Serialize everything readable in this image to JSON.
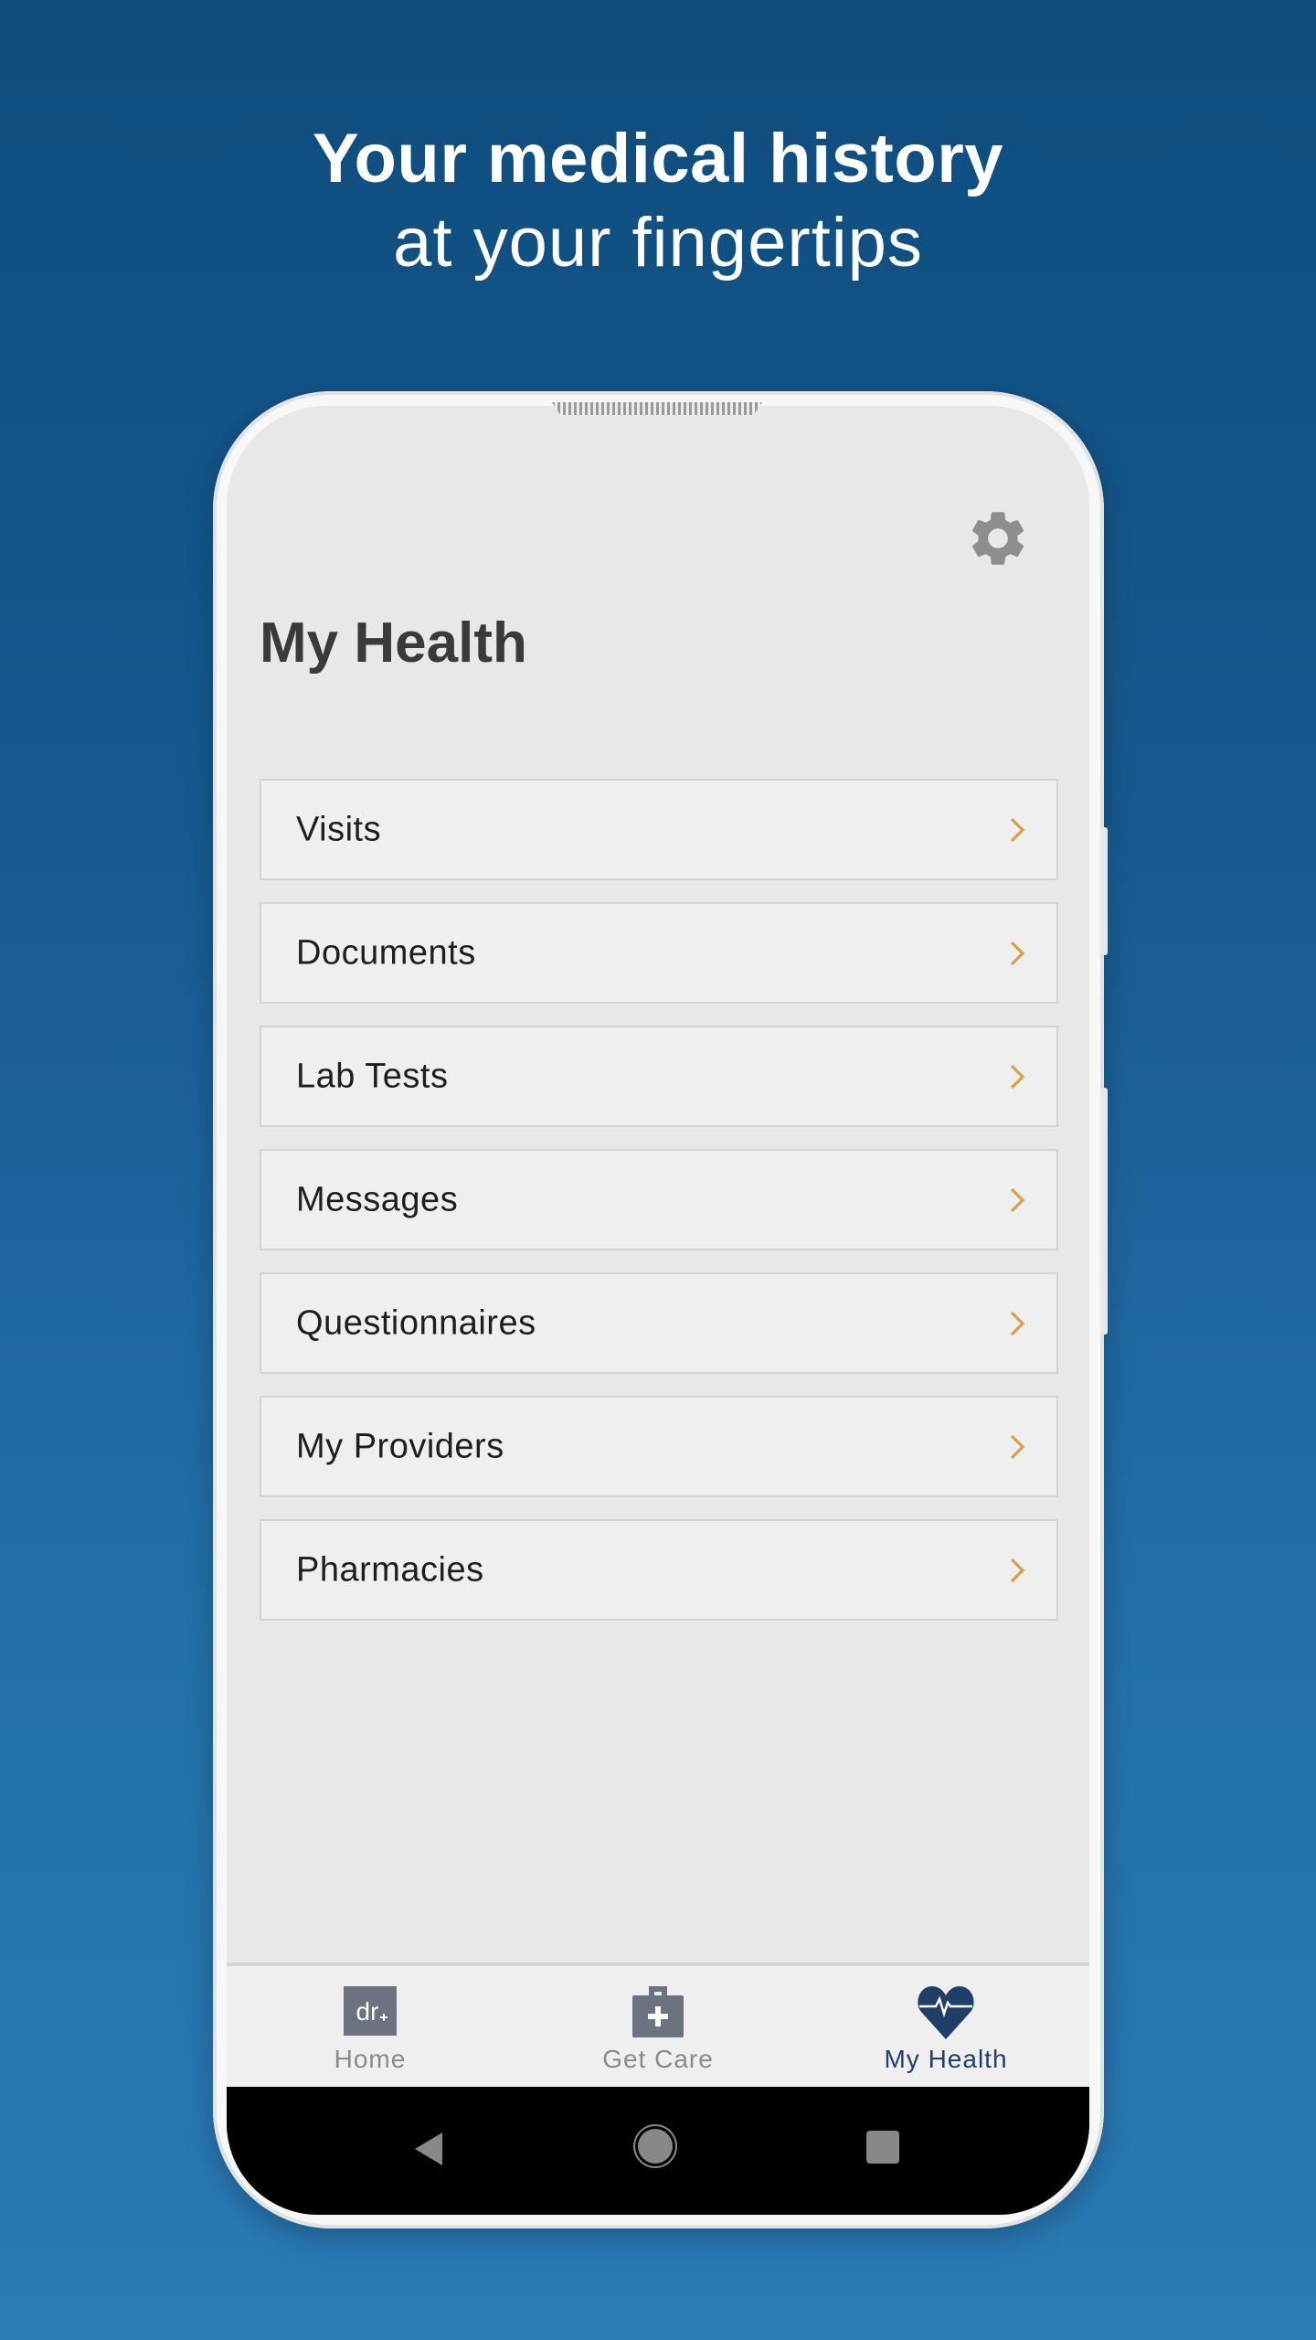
{
  "promo": {
    "headline_bold": "Your medical history",
    "headline_light": "at your fingertips"
  },
  "colors": {
    "background_top": "#0e4c7d",
    "background_bottom": "#2a7ab5",
    "chevron": "#d9a04a",
    "active_tab": "#1f3f6b",
    "inactive_tab": "#8a8a8a"
  },
  "header": {
    "title": "My Health",
    "settings_icon": "gear-icon"
  },
  "menu": {
    "items": [
      {
        "label": "Visits",
        "icon": "chevron-right-icon"
      },
      {
        "label": "Documents",
        "icon": "chevron-right-icon"
      },
      {
        "label": "Lab Tests",
        "icon": "chevron-right-icon"
      },
      {
        "label": "Messages",
        "icon": "chevron-right-icon"
      },
      {
        "label": "Questionnaires",
        "icon": "chevron-right-icon"
      },
      {
        "label": "My Providers",
        "icon": "chevron-right-icon"
      },
      {
        "label": "Pharmacies",
        "icon": "chevron-right-icon"
      }
    ]
  },
  "bottom_nav": {
    "tabs": [
      {
        "label": "Home",
        "icon": "dr-logo-icon",
        "icon_text": "dr",
        "active": false
      },
      {
        "label": "Get Care",
        "icon": "medical-kit-icon",
        "active": false
      },
      {
        "label": "My Health",
        "icon": "heart-pulse-icon",
        "active": true
      }
    ]
  },
  "system_nav": {
    "buttons": [
      "back",
      "home",
      "recents"
    ]
  }
}
